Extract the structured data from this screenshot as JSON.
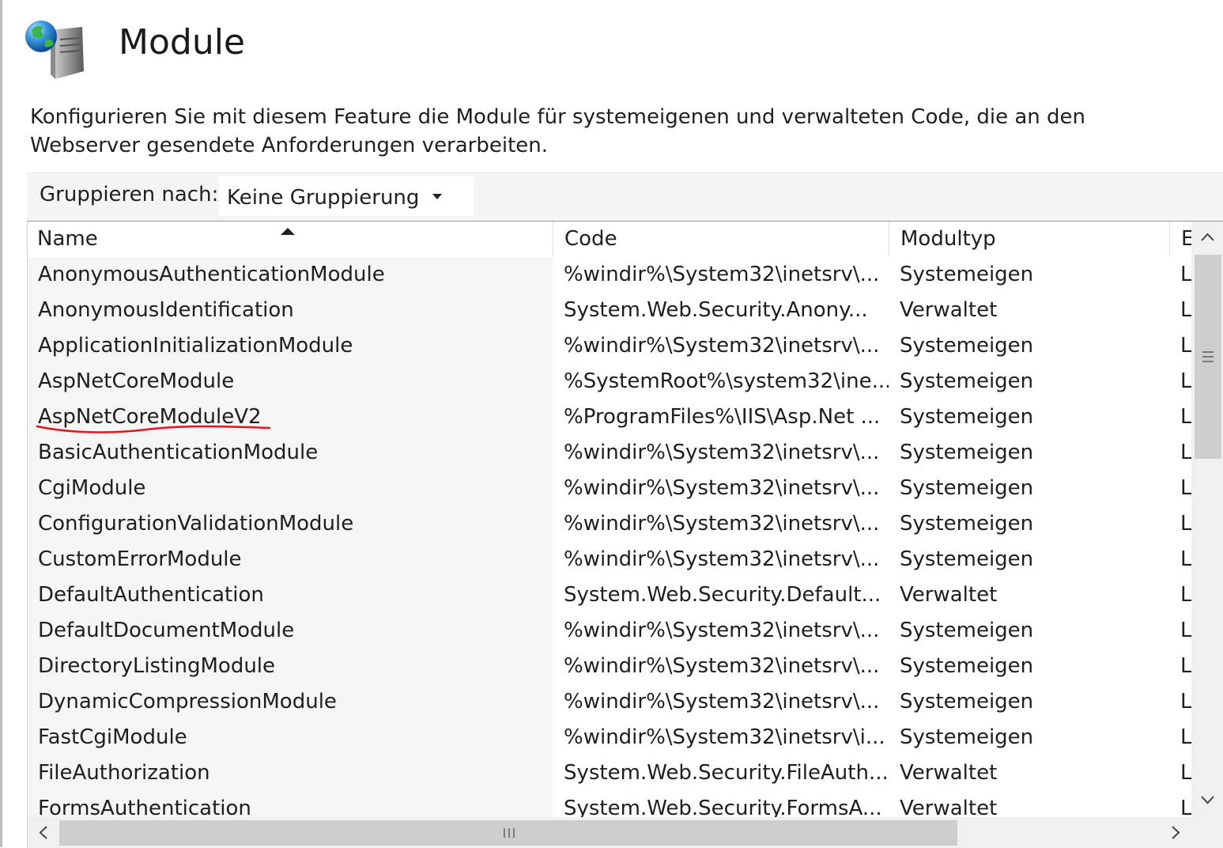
{
  "header": {
    "title": "Module",
    "icon": "globe-server-icon",
    "description": "Konfigurieren Sie mit diesem Feature die Module für systemeigenen und verwalteten Code, die an den Webserver gesendete Anforderungen verarbeiten."
  },
  "toolbar": {
    "group_by_label": "Gruppieren nach:",
    "group_by_value": "Keine Gruppierung"
  },
  "columns": {
    "name": "Name",
    "code": "Code",
    "type": "Modultyp",
    "entry": "E"
  },
  "sort": {
    "column": "Name",
    "direction": "ascending"
  },
  "rows": [
    {
      "name": "AnonymousAuthenticationModule",
      "code": "%windir%\\System32\\inetsrv\\...",
      "type": "Systemeigen",
      "entry": "L"
    },
    {
      "name": "AnonymousIdentification",
      "code": "System.Web.Security.Anony...",
      "type": "Verwaltet",
      "entry": "L"
    },
    {
      "name": "ApplicationInitializationModule",
      "code": "%windir%\\System32\\inetsrv\\...",
      "type": "Systemeigen",
      "entry": "L"
    },
    {
      "name": "AspNetCoreModule",
      "code": "%SystemRoot%\\system32\\ine...",
      "type": "Systemeigen",
      "entry": "L"
    },
    {
      "name": "AspNetCoreModuleV2",
      "code": "%ProgramFiles%\\IIS\\Asp.Net ...",
      "type": "Systemeigen",
      "entry": "L",
      "annotated": true
    },
    {
      "name": "BasicAuthenticationModule",
      "code": "%windir%\\System32\\inetsrv\\...",
      "type": "Systemeigen",
      "entry": "L"
    },
    {
      "name": "CgiModule",
      "code": "%windir%\\System32\\inetsrv\\...",
      "type": "Systemeigen",
      "entry": "L"
    },
    {
      "name": "ConfigurationValidationModule",
      "code": "%windir%\\System32\\inetsrv\\...",
      "type": "Systemeigen",
      "entry": "L"
    },
    {
      "name": "CustomErrorModule",
      "code": "%windir%\\System32\\inetsrv\\...",
      "type": "Systemeigen",
      "entry": "L"
    },
    {
      "name": "DefaultAuthentication",
      "code": "System.Web.Security.Default...",
      "type": "Verwaltet",
      "entry": "L"
    },
    {
      "name": "DefaultDocumentModule",
      "code": "%windir%\\System32\\inetsrv\\...",
      "type": "Systemeigen",
      "entry": "L"
    },
    {
      "name": "DirectoryListingModule",
      "code": "%windir%\\System32\\inetsrv\\...",
      "type": "Systemeigen",
      "entry": "L"
    },
    {
      "name": "DynamicCompressionModule",
      "code": "%windir%\\System32\\inetsrv\\...",
      "type": "Systemeigen",
      "entry": "L"
    },
    {
      "name": "FastCgiModule",
      "code": "%windir%\\System32\\inetsrv\\i...",
      "type": "Systemeigen",
      "entry": "L"
    },
    {
      "name": "FileAuthorization",
      "code": "System.Web.Security.FileAuth...",
      "type": "Verwaltet",
      "entry": "L"
    },
    {
      "name": "FormsAuthentication",
      "code": "System.Web.Security.FormsA...",
      "type": "Verwaltet",
      "entry": "L"
    }
  ],
  "colors": {
    "annotation": "#e8141b",
    "name_column_bg": "#f5f5f5",
    "scroll_thumb": "#cdcdcd"
  }
}
